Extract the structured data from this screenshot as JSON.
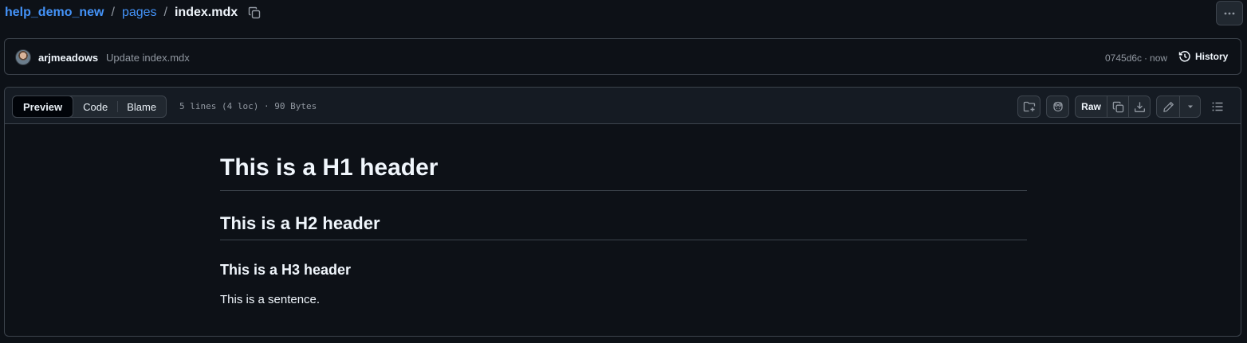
{
  "breadcrumb": {
    "repo": "help_demo_new",
    "folder": "pages",
    "file": "index.mdx",
    "separator": "/"
  },
  "commit": {
    "author": "arjmeadows",
    "message": "Update index.mdx",
    "sha": "0745d6c",
    "separator": "·",
    "time": "now",
    "history_label": "History"
  },
  "file_header": {
    "tabs": [
      {
        "label": "Preview",
        "active": true
      },
      {
        "label": "Code",
        "active": false
      },
      {
        "label": "Blame",
        "active": false
      }
    ],
    "info": "5 lines (4 loc) · 90 Bytes",
    "raw_label": "Raw"
  },
  "content": {
    "h1": "This is a H1 header",
    "h2": "This is a H2 header",
    "h3": "This is a H3 header",
    "paragraph": "This is a sentence."
  },
  "icons": [
    "copy-icon",
    "kebab-horizontal-icon",
    "history-icon",
    "add-to-folder-icon",
    "copilot-icon",
    "copy-raw-icon",
    "download-icon",
    "pencil-icon",
    "triangle-down-icon",
    "list-unordered-icon"
  ],
  "colors": {
    "background": "#0d1117",
    "header_background": "#151b23",
    "border": "#3d444d",
    "link": "#4493f8",
    "muted_text": "#9198a1",
    "text": "#f0f6fc"
  }
}
